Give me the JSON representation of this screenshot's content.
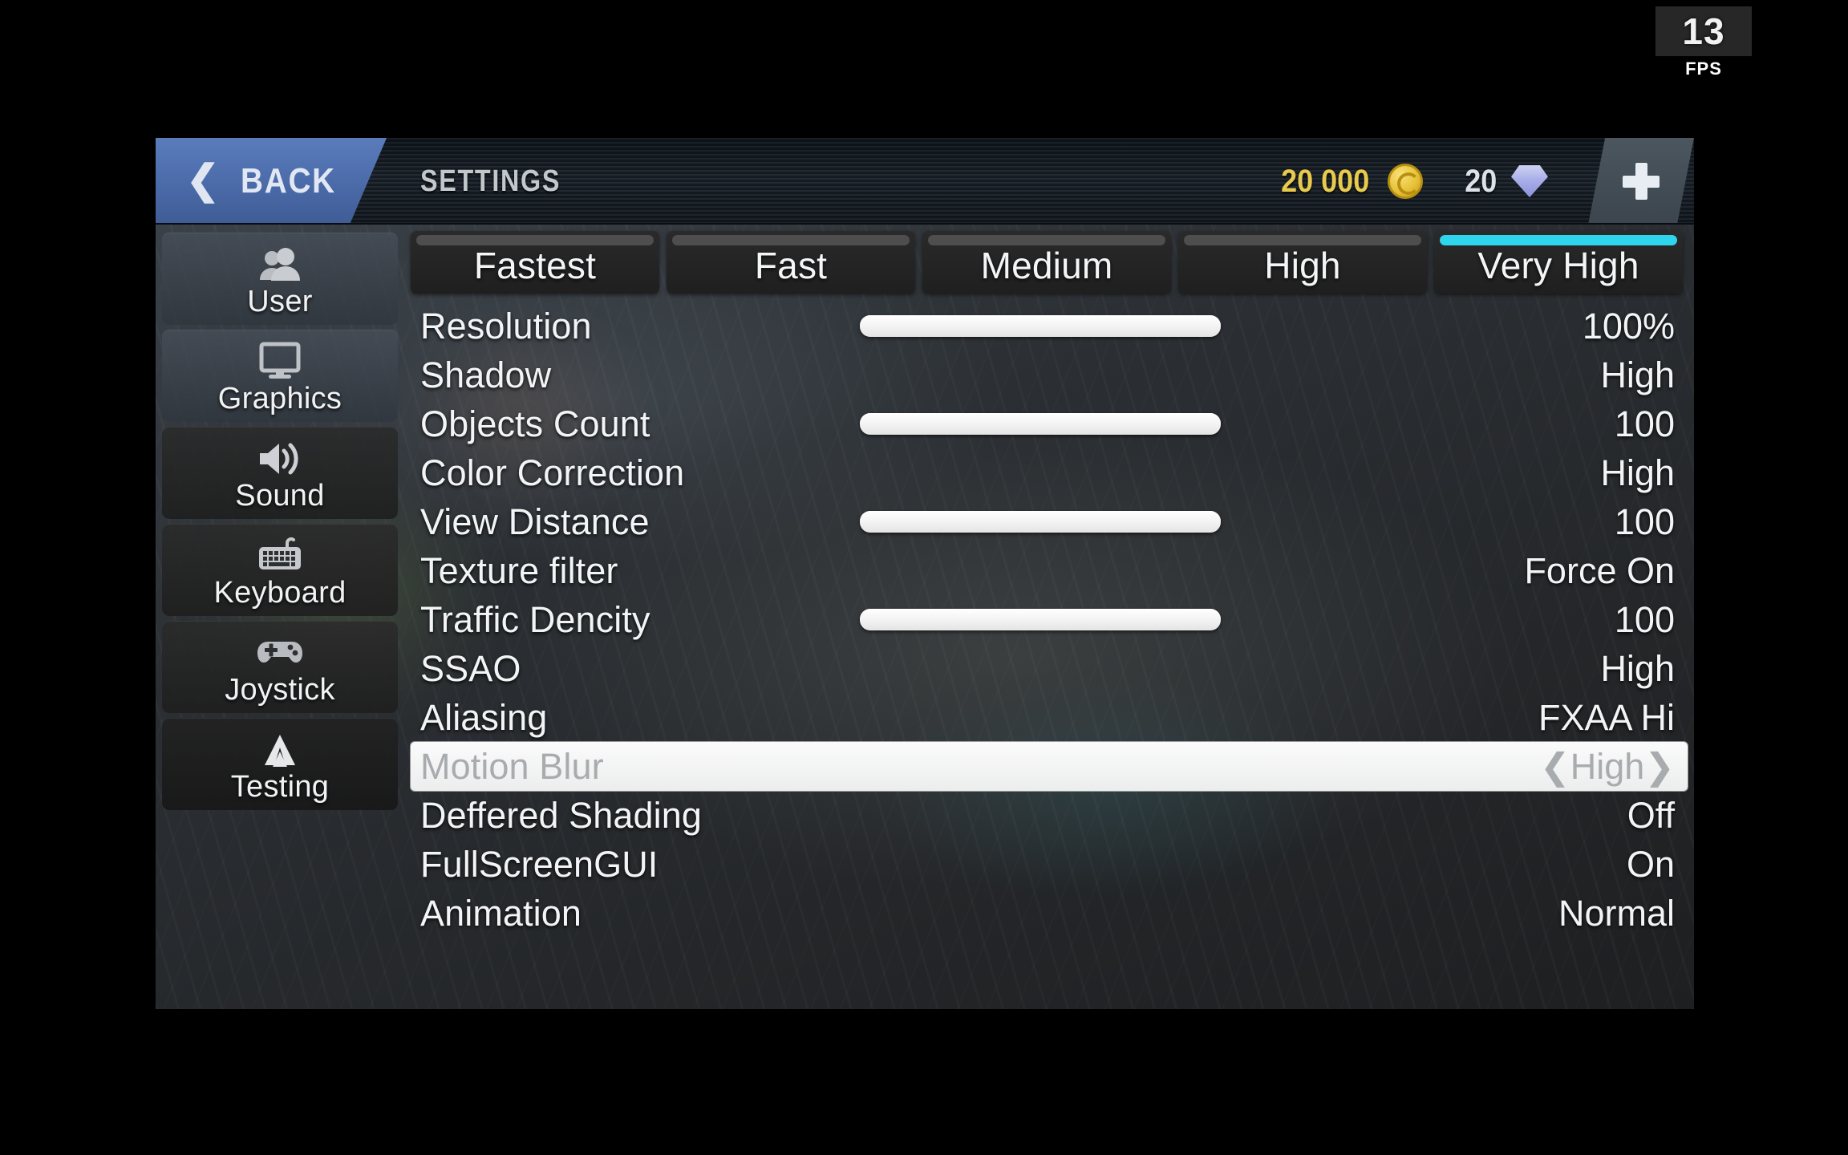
{
  "hud": {
    "fps_value": "13",
    "fps_label": "FPS"
  },
  "header": {
    "back_label": "BACK",
    "back_chevron": "❮",
    "title": "SETTINGS",
    "coin_amount": "20 000",
    "coin_icon": "coin-icon",
    "gem_amount": "20",
    "gem_icon": "diamond-icon",
    "add_icon": "plus-icon"
  },
  "sidebar": {
    "items": [
      {
        "label": "User",
        "icon": "users-icon"
      },
      {
        "label": "Graphics",
        "icon": "monitor-icon"
      },
      {
        "label": "Sound",
        "icon": "speaker-icon"
      },
      {
        "label": "Keyboard",
        "icon": "keyboard-icon"
      },
      {
        "label": "Joystick",
        "icon": "gamepad-icon"
      },
      {
        "label": "Testing",
        "icon": "triangle-logo-icon"
      }
    ]
  },
  "quality_tabs": {
    "selected": "Very High",
    "items": [
      {
        "label": "Fastest",
        "active": false
      },
      {
        "label": "Fast",
        "active": false
      },
      {
        "label": "Medium",
        "active": false
      },
      {
        "label": "High",
        "active": false
      },
      {
        "label": "Very High",
        "active": true
      }
    ]
  },
  "settings": {
    "rows": [
      {
        "name": "Resolution",
        "value": "100%",
        "slider": true,
        "selected": false
      },
      {
        "name": "Shadow",
        "value": "High",
        "slider": false,
        "selected": false
      },
      {
        "name": "Objects Count",
        "value": "100",
        "slider": true,
        "selected": false
      },
      {
        "name": "Color Correction",
        "value": "High",
        "slider": false,
        "selected": false
      },
      {
        "name": "View Distance",
        "value": "100",
        "slider": true,
        "selected": false
      },
      {
        "name": "Texture filter",
        "value": "Force On",
        "slider": false,
        "selected": false
      },
      {
        "name": "Traffic Dencity",
        "value": "100",
        "slider": true,
        "selected": false
      },
      {
        "name": "SSAO",
        "value": "High",
        "slider": false,
        "selected": false
      },
      {
        "name": "Aliasing",
        "value": "FXAA Hi",
        "slider": false,
        "selected": false
      },
      {
        "name": "Motion Blur",
        "value": "❮High❯",
        "slider": false,
        "selected": true
      },
      {
        "name": "Deffered Shading",
        "value": "Off",
        "slider": false,
        "selected": false
      },
      {
        "name": "FullScreenGUI",
        "value": "On",
        "slider": false,
        "selected": false
      },
      {
        "name": "Animation",
        "value": "Normal",
        "slider": false,
        "selected": false
      }
    ]
  },
  "colors": {
    "accent_cyan": "#2ed5ec",
    "back_blue": "#4a6aa8",
    "coin_gold": "#e8cb4d",
    "gem_purple": "#a9afe8"
  }
}
